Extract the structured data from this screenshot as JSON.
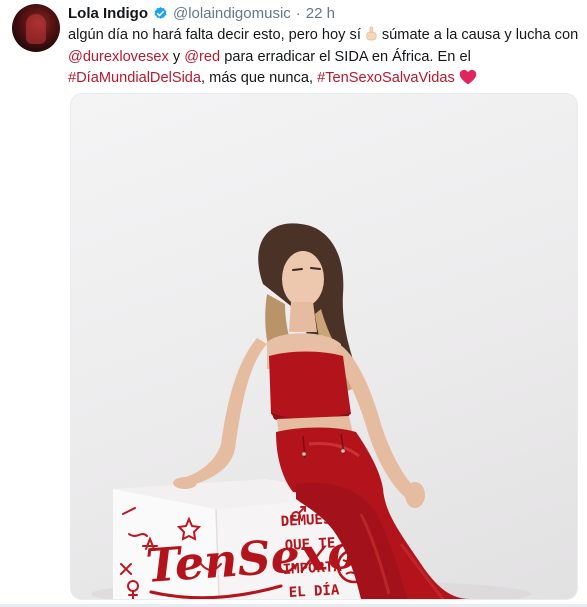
{
  "tweet": {
    "author_name": "Lola Indigo",
    "handle": "@lolaindigomusic",
    "separator": "·",
    "time": "22 h",
    "verified": true,
    "text": {
      "l1_a": "algún día no hará falta decir esto, pero hoy sí",
      "l1_b": "súmate a la causa y lucha con",
      "l2_mention1": "@durexlovesex",
      "l2_and": "y",
      "l2_mention2": "@red",
      "l2_rest": "para erradicar el SIDA en África. En el",
      "l3_hashtag1": "#DíaMundialDelSida",
      "l3_mid": ", más que nunca,",
      "l3_hashtag2": "#TenSexoSalvaVidas"
    }
  },
  "media": {
    "box_brand": "TenSexo",
    "box_slogan_lines": [
      "DEMUESTRA",
      "QUE TE",
      "IMPORTA",
      "EL DÍA"
    ]
  },
  "colors": {
    "link": "#b8192e",
    "verified_blue": "#1da1f2",
    "heart": "#e0245e",
    "outfit_red": "#b3141b"
  },
  "icons": {
    "verified": "verified-badge-icon",
    "finger": "index-finger-emoji",
    "heart": "red-heart-emoji"
  }
}
